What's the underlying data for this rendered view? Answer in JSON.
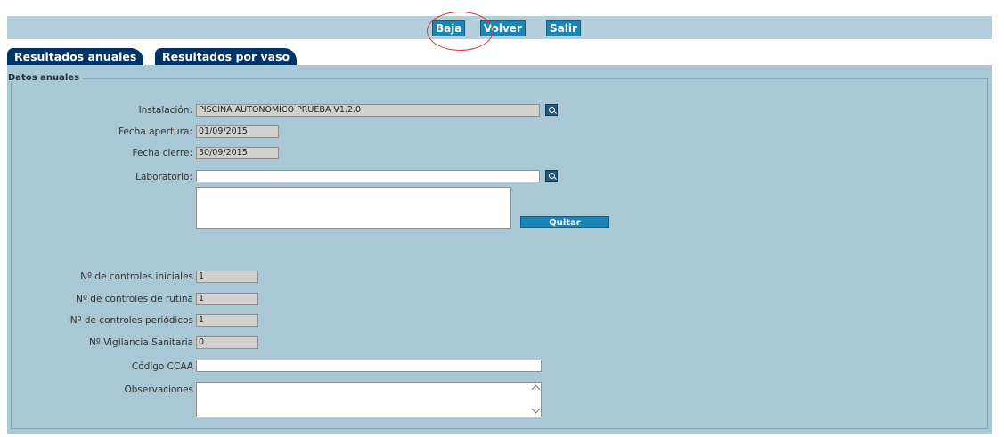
{
  "toolbar": {
    "baja_label": "Baja",
    "volver_label": "Volver",
    "salir_label": "Salir"
  },
  "tabs": [
    {
      "label": "Resultados anuales"
    },
    {
      "label": "Resultados por vaso"
    }
  ],
  "section": {
    "legend": "Datos anuales"
  },
  "form": {
    "instalacion_label": "Instalación:",
    "instalacion_value": "PISCINA AUTONOMICO PRUEBA V1.2.0",
    "fecha_apertura_label": "Fecha apertura:",
    "fecha_apertura_value": "01/09/2015",
    "fecha_cierre_label": "Fecha cierre:",
    "fecha_cierre_value": "30/09/2015",
    "laboratorio_label": "Laboratorio:",
    "laboratorio_value": "",
    "quitar_label": "Quitar",
    "controles_iniciales_label": "Nº de controles iniciales",
    "controles_iniciales_value": "1",
    "controles_rutina_label": "Nº de controles de rutina",
    "controles_rutina_value": "1",
    "controles_periodicos_label": "Nº de controles periódicos",
    "controles_periodicos_value": "1",
    "vigilancia_label": "Nº Vigilancia Sanitaria",
    "vigilancia_value": "0",
    "codigo_ccaa_label": "Código CCAA",
    "codigo_ccaa_value": "",
    "observaciones_label": "Observaciones",
    "observaciones_value": ""
  },
  "colors": {
    "toolbar_bg": "#b3cfda",
    "panel_bg": "#a9c7d4",
    "tab_bg": "#003366",
    "button_bg": "#1a86b8",
    "annotation": "#d23b3b"
  },
  "icons": [
    "search-icon",
    "scroll-up-icon",
    "scroll-down-icon"
  ]
}
